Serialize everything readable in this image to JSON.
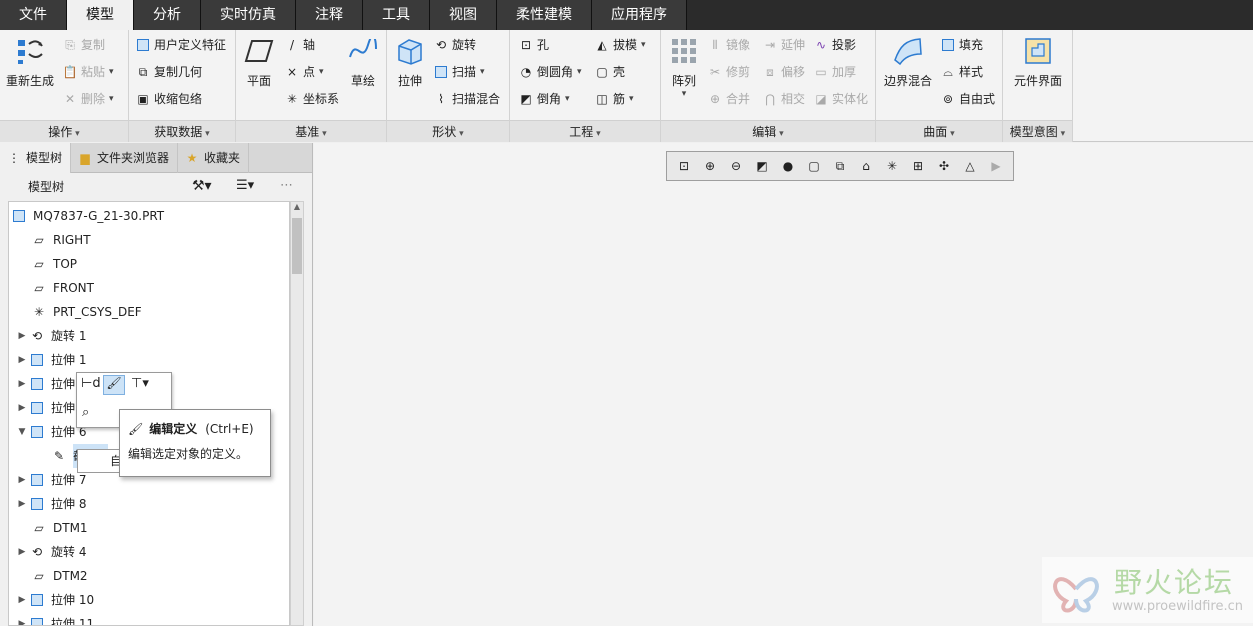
{
  "menu_tabs": [
    "文件",
    "模型",
    "分析",
    "实时仿真",
    "注释",
    "工具",
    "视图",
    "柔性建模",
    "应用程序"
  ],
  "ribbon": {
    "groups": {
      "operations": "操作",
      "get_data": "获取数据",
      "datum": "基准",
      "shapes": "形状",
      "engineering": "工程",
      "editing": "编辑",
      "surfaces": "曲面",
      "model_intent": "模型意图"
    },
    "operations": {
      "regenerate": "重新生成",
      "copy": "复制",
      "paste": "粘贴",
      "delete": "删除"
    },
    "get_data": {
      "udf": "用户定义特征",
      "copy_geom": "复制几何",
      "shrinkwrap": "收缩包络"
    },
    "datum": {
      "plane": "平面",
      "axis": "轴",
      "point": "点",
      "csys": "坐标系",
      "sketch": "草绘"
    },
    "shapes": {
      "extrude": "拉伸",
      "revolve": "旋转",
      "sweep": "扫描",
      "swept_blend": "扫描混合"
    },
    "engineering": {
      "hole": "孔",
      "round": "倒圆角",
      "chamfer": "倒角",
      "draft": "拔模",
      "shell": "壳",
      "rib": "筋"
    },
    "editing": {
      "pattern": "阵列",
      "mirror": "镜像",
      "extend": "延伸",
      "project": "投影",
      "trim": "修剪",
      "offset": "偏移",
      "thicken": "加厚",
      "merge": "合并",
      "intersect": "相交",
      "solidify": "实体化"
    },
    "surfaces": {
      "boundary_blend": "边界混合",
      "fill": "填充",
      "style": "样式",
      "freestyle": "自由式"
    },
    "model_intent": {
      "component_interface": "元件界面"
    }
  },
  "panel": {
    "tabs": [
      "模型树",
      "文件夹浏览器",
      "收藏夹"
    ],
    "tree_title": "模型树"
  },
  "tree": {
    "root": "MQ7837-G_21-30.PRT",
    "items": [
      "RIGHT",
      "TOP",
      "FRONT",
      "PRT_CSYS_DEF",
      "旋转 1",
      "拉伸 1",
      "拉伸",
      "拉伸",
      "拉伸 6",
      "截面 1",
      "拉伸 7",
      "拉伸 8",
      "DTM1",
      "旋转 4",
      "DTM2",
      "拉伸 10",
      "拉伸 11"
    ]
  },
  "tooltip": {
    "title": "编辑定义",
    "shortcut": "(Ctrl+E)",
    "description": "编辑选定对象的定义。"
  },
  "context_item": "自",
  "watermark": {
    "name": "野火论坛",
    "url": "www.proewildfire.cn"
  },
  "colors": {
    "menubar": "#2b2b2b",
    "accent": "#2d7bd0"
  }
}
